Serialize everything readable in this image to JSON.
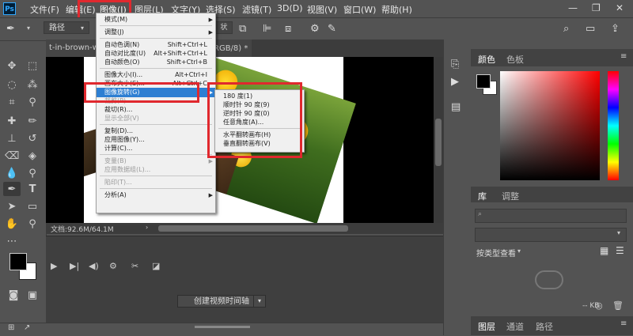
{
  "menubar": {
    "logo": "Ps",
    "items": [
      "文件(F)",
      "编辑(E)",
      "图像(I)",
      "图层(L)",
      "文字(Y)",
      "选择(S)",
      "滤镜(T)",
      "3D(D)",
      "视图(V)",
      "窗口(W)",
      "帮助(H)"
    ],
    "win_minimize": "—",
    "win_restore": "❐",
    "win_close": "✕"
  },
  "options": {
    "path_mode": "路径",
    "shape_label": "状"
  },
  "document": {
    "tab_title": "t-in-brown-wo",
    "tab_suffix": "RGB/8) *",
    "status": "文档:92.6M/64.1M"
  },
  "timeline": {
    "create_button": "创建视频时间轴"
  },
  "panels": {
    "color_tabs": [
      "颜色",
      "色板"
    ],
    "lib_tabs": [
      "库",
      "调整"
    ],
    "view_by": "按类型查看",
    "kb_label": "-- KB",
    "layer_tabs": [
      "图层",
      "通道",
      "路径"
    ]
  },
  "image_menu": {
    "items": [
      {
        "label": "模式(M)",
        "shortcut": "",
        "submenu": true,
        "disabled": false,
        "highlight": false
      },
      {
        "sep": true
      },
      {
        "label": "调整(J)",
        "shortcut": "",
        "submenu": true,
        "disabled": false,
        "highlight": false
      },
      {
        "sep": true
      },
      {
        "label": "自动色调(N)",
        "shortcut": "Shift+Ctrl+L",
        "submenu": false,
        "disabled": false,
        "highlight": false
      },
      {
        "label": "自动对比度(U)",
        "shortcut": "Alt+Shift+Ctrl+L",
        "submenu": false,
        "disabled": false,
        "highlight": false
      },
      {
        "label": "自动颜色(O)",
        "shortcut": "Shift+Ctrl+B",
        "submenu": false,
        "disabled": false,
        "highlight": false
      },
      {
        "sep": true
      },
      {
        "label": "图像大小(I)...",
        "shortcut": "Alt+Ctrl+I",
        "submenu": false,
        "disabled": false,
        "highlight": false
      },
      {
        "label": "画布大小(S)...",
        "shortcut": "Alt+Ctrl+C",
        "submenu": false,
        "disabled": false,
        "highlight": false
      },
      {
        "label": "图像旋转(G)",
        "shortcut": "",
        "submenu": true,
        "disabled": false,
        "highlight": true
      },
      {
        "label": "裁剪(P)",
        "shortcut": "",
        "submenu": false,
        "disabled": true,
        "highlight": false
      },
      {
        "label": "裁切(R)...",
        "shortcut": "",
        "submenu": false,
        "disabled": false,
        "highlight": false
      },
      {
        "label": "显示全部(V)",
        "shortcut": "",
        "submenu": false,
        "disabled": true,
        "highlight": false
      },
      {
        "sep": true
      },
      {
        "label": "复制(D)...",
        "shortcut": "",
        "submenu": false,
        "disabled": false,
        "highlight": false
      },
      {
        "label": "应用图像(Y)...",
        "shortcut": "",
        "submenu": false,
        "disabled": false,
        "highlight": false
      },
      {
        "label": "计算(C)...",
        "shortcut": "",
        "submenu": false,
        "disabled": false,
        "highlight": false
      },
      {
        "sep": true
      },
      {
        "label": "变量(B)",
        "shortcut": "",
        "submenu": true,
        "disabled": true,
        "highlight": false
      },
      {
        "label": "应用数据组(L)...",
        "shortcut": "",
        "submenu": false,
        "disabled": true,
        "highlight": false
      },
      {
        "sep": true
      },
      {
        "label": "陷印(T)...",
        "shortcut": "",
        "submenu": false,
        "disabled": true,
        "highlight": false
      },
      {
        "sep": true
      },
      {
        "label": "分析(A)",
        "shortcut": "",
        "submenu": true,
        "disabled": false,
        "highlight": false
      }
    ]
  },
  "rotate_submenu": {
    "items": [
      {
        "label": "180 度(1)"
      },
      {
        "label": "顺时针 90 度(9)"
      },
      {
        "label": "逆时针 90 度(0)"
      },
      {
        "label": "任意角度(A)..."
      },
      {
        "sep": true
      },
      {
        "label": "水平翻转画布(H)"
      },
      {
        "label": "垂直翻转画布(V)"
      }
    ]
  },
  "colors": {
    "highlight": "#2d7fd2",
    "annotation_red": "#e0282e"
  }
}
